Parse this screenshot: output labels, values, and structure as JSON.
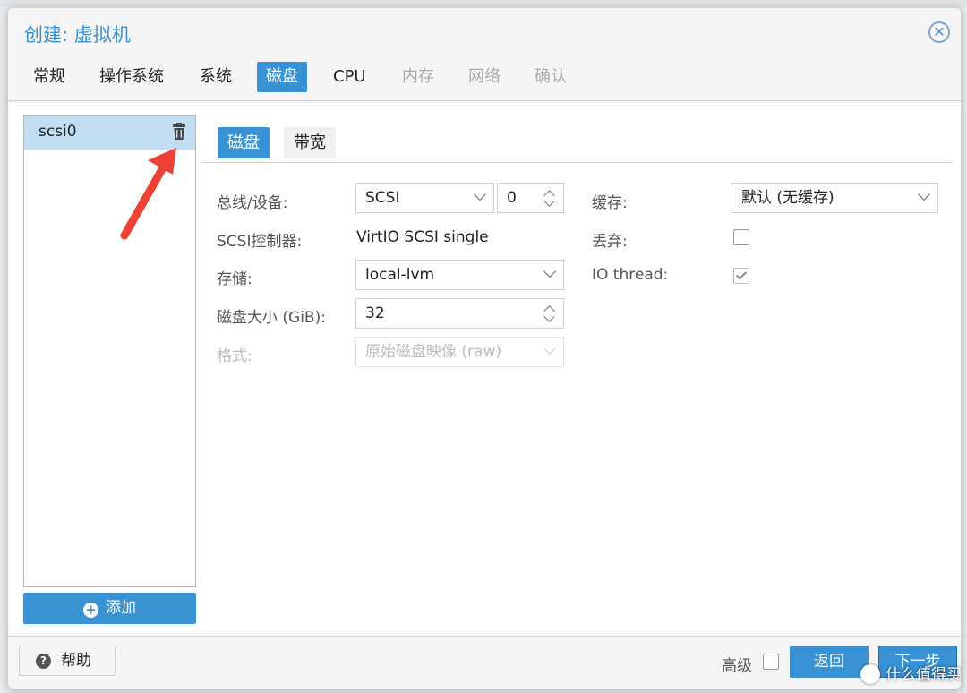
{
  "dialog": {
    "title": "创建: 虚拟机",
    "close_icon": "close-circle-icon"
  },
  "tabs": [
    {
      "label": "常规",
      "state": "normal"
    },
    {
      "label": "操作系统",
      "state": "normal"
    },
    {
      "label": "系统",
      "state": "normal"
    },
    {
      "label": "磁盘",
      "state": "active"
    },
    {
      "label": "CPU",
      "state": "normal"
    },
    {
      "label": "内存",
      "state": "disabled"
    },
    {
      "label": "网络",
      "state": "disabled"
    },
    {
      "label": "确认",
      "state": "disabled"
    }
  ],
  "disk_list": {
    "items": [
      {
        "label": "scsi0",
        "icon": "trash-icon",
        "selected": true
      }
    ],
    "add_label": "添加",
    "add_icon": "plus-circle-icon"
  },
  "subtabs": [
    {
      "label": "磁盘",
      "active": true
    },
    {
      "label": "带宽",
      "active": false
    }
  ],
  "form": {
    "bus_label": "总线/设备:",
    "bus_value": "SCSI",
    "device_number": "0",
    "controller_label": "SCSI控制器:",
    "controller_value": "VirtIO SCSI single",
    "storage_label": "存储:",
    "storage_value": "local-lvm",
    "size_label": "磁盘大小 (GiB):",
    "size_value": "32",
    "format_label": "格式:",
    "format_value": "原始磁盘映像 (raw)",
    "cache_label": "缓存:",
    "cache_value": "默认 (无缓存)",
    "discard_label": "丢弃:",
    "discard_checked": false,
    "iothread_label": "IO thread:",
    "iothread_checked": true
  },
  "footer": {
    "help_label": "帮助",
    "help_icon": "question-circle-icon",
    "advanced_label": "高级",
    "advanced_checked": false,
    "back_label": "返回",
    "next_label": "下一步"
  },
  "watermark": {
    "text": "什么值得买"
  },
  "colors": {
    "accent": "#3892d4",
    "selected_row": "#c1ddf1",
    "annotation_arrow": "#ee4136"
  }
}
